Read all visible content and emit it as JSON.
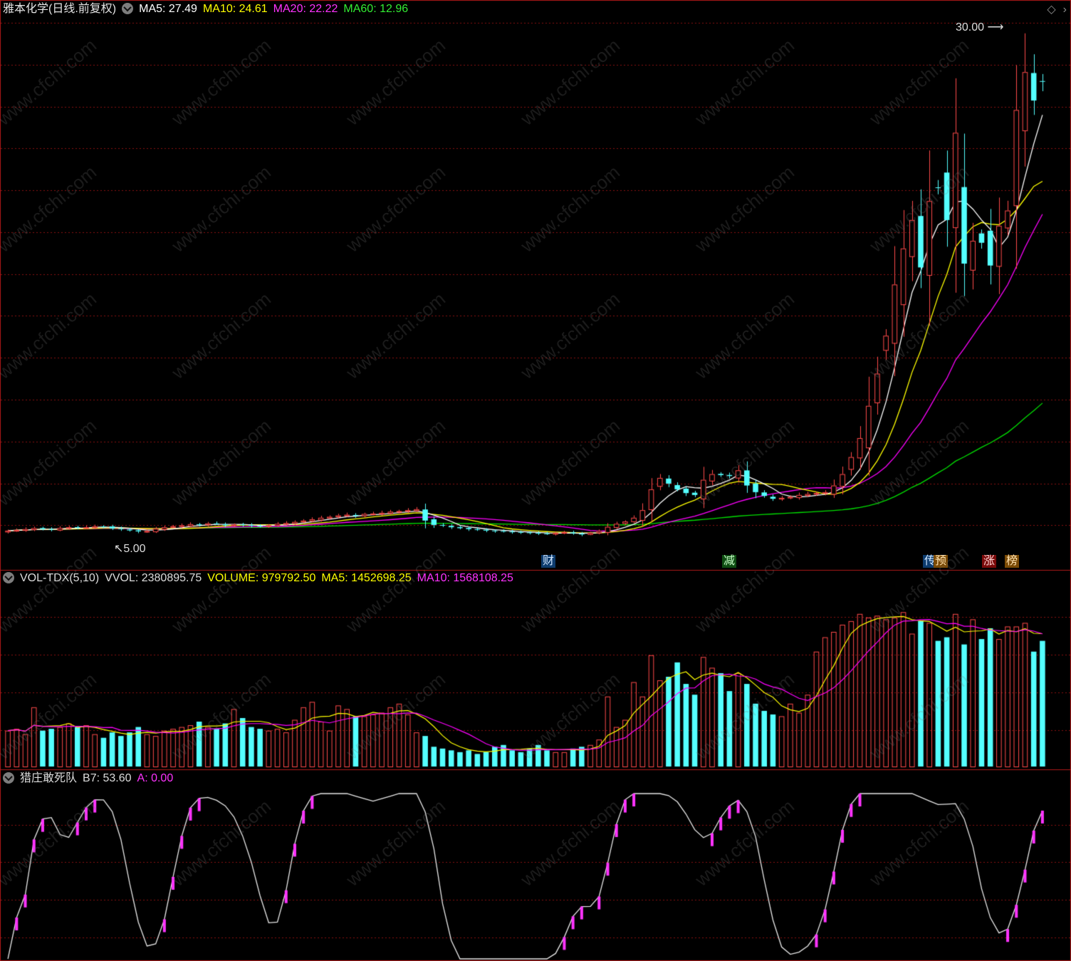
{
  "header_main": {
    "title": "雅本化学(日线.前复权)",
    "ma5_label": "MA5: 27.49",
    "ma10_label": "MA10: 24.61",
    "ma20_label": "MA20: 22.22",
    "ma60_label": "MA60: 12.96"
  },
  "header_vol": {
    "title": "VOL-TDX(5,10)",
    "vvol": "VVOL: 2380895.75",
    "volume": "VOLUME: 979792.50",
    "ma5": "MA5: 1452698.25",
    "ma10": "MA10: 1568108.25"
  },
  "header_ind": {
    "title": "猎庄敢死队",
    "b7": "B7: 53.60",
    "a": "A: 0.00"
  },
  "annotations": {
    "high": "30.00",
    "low": "5.00"
  },
  "event_marks": [
    {
      "text": "财",
      "color": "#4aa3ff"
    },
    {
      "text": "减",
      "color": "#3fc13f"
    },
    {
      "text": "传",
      "color": "#4aa3ff"
    },
    {
      "text": "预",
      "color": "#ff9a1a"
    },
    {
      "text": "涨",
      "color": "#ff3c3c"
    },
    {
      "text": "榜",
      "color": "#ff9a1a"
    }
  ],
  "watermark": "www.cfchi.com",
  "colors": {
    "up": "#ff4a4a",
    "down": "#54ffff",
    "ma5": "#ffffff",
    "ma10": "#ffff00",
    "ma20": "#ff00ff",
    "ma60": "#00e000",
    "grid": "#8a1010",
    "border": "#b01818"
  },
  "chart_data": {
    "type": "candlestick",
    "price_axis": {
      "min": 3.5,
      "max": 32.5
    },
    "days": 120,
    "price_series": [
      {
        "name": "MA5",
        "values_ref": "ma5"
      },
      {
        "name": "MA10",
        "values_ref": "ma10"
      },
      {
        "name": "MA20",
        "values_ref": "ma20"
      },
      {
        "name": "MA60",
        "values_ref": "ma60"
      }
    ],
    "close": [
      5.42,
      5.45,
      5.5,
      5.55,
      5.5,
      5.48,
      5.56,
      5.6,
      5.58,
      5.6,
      5.64,
      5.62,
      5.54,
      5.5,
      5.43,
      5.38,
      5.4,
      5.52,
      5.6,
      5.65,
      5.7,
      5.76,
      5.72,
      5.8,
      5.78,
      5.7,
      5.74,
      5.72,
      5.68,
      5.65,
      5.7,
      5.78,
      5.82,
      5.88,
      5.95,
      6.02,
      6.1,
      6.15,
      6.22,
      6.26,
      6.2,
      6.3,
      6.32,
      6.36,
      6.42,
      6.45,
      6.5,
      6.55,
      5.95,
      5.72,
      5.7,
      5.6,
      5.55,
      5.5,
      5.48,
      5.42,
      5.4,
      5.38,
      5.35,
      5.32,
      5.3,
      5.28,
      5.25,
      5.3,
      5.34,
      5.28,
      5.22,
      5.3,
      5.4,
      5.62,
      5.78,
      5.9,
      6.1,
      6.5,
      7.6,
      8.2,
      7.9,
      7.6,
      7.4,
      7.3,
      8.1,
      8.4,
      8.35,
      8.3,
      8.6,
      7.8,
      7.45,
      7.25,
      7.1,
      7.15,
      7.2,
      7.3,
      7.35,
      7.4,
      7.45,
      7.8,
      8.4,
      9.3,
      10.3,
      12.0,
      13.7,
      15.7,
      18.4,
      20.3,
      21.8,
      19.3,
      22.8,
      23.5,
      21.8,
      26.4,
      19.5,
      20.7,
      20.6,
      19.4,
      21.5,
      22.3,
      27.6,
      29.6,
      28.1,
      29.1
    ],
    "volume": [
      20,
      21,
      18,
      33,
      20,
      21,
      22,
      24,
      22,
      23,
      18,
      16,
      19,
      17,
      19,
      22,
      18,
      17,
      20,
      21,
      22,
      23,
      25,
      22,
      21,
      24,
      32,
      27,
      22,
      21,
      20,
      21,
      19,
      26,
      33,
      36,
      25,
      20,
      34,
      32,
      28,
      28,
      29,
      30,
      33,
      35,
      29,
      19,
      17,
      11,
      10,
      9,
      8,
      9,
      7,
      8,
      11,
      12,
      9,
      8,
      10,
      12,
      9,
      8,
      8,
      10,
      11,
      12,
      15,
      39,
      22,
      26,
      47,
      39,
      62,
      48,
      50,
      58,
      46,
      40,
      61,
      55,
      52,
      42,
      52,
      46,
      35,
      31,
      29,
      28,
      35,
      30,
      40,
      64,
      72,
      75,
      79,
      81,
      85,
      83,
      84,
      82,
      83,
      86,
      74,
      81,
      80,
      70,
      72,
      85,
      68,
      82,
      71,
      77,
      71,
      78,
      78,
      80,
      64,
      70
    ]
  }
}
